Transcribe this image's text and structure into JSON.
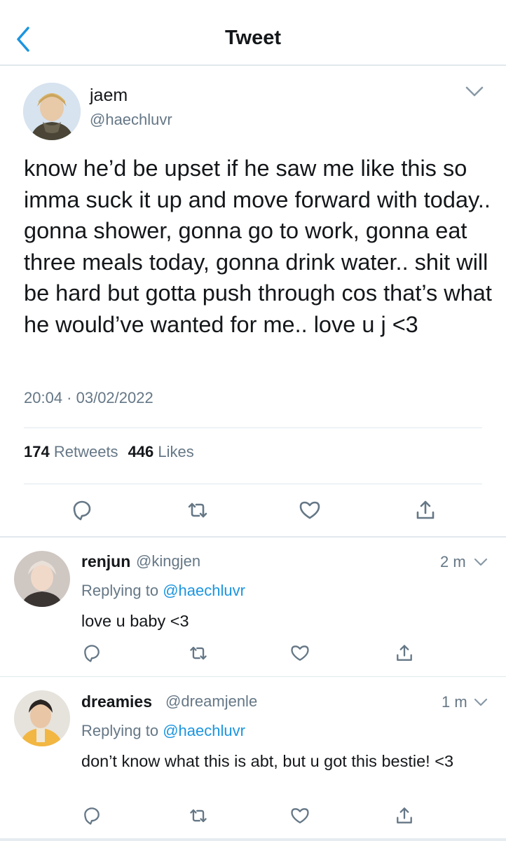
{
  "header": {
    "title": "Tweet"
  },
  "main_tweet": {
    "name": "jaem",
    "handle": "@haechluvr",
    "text": "know he’d be upset if he saw me like this so imma suck it up and move forward with today.. gonna shower, gonna go to work, gonna eat three meals today, gonna drink water.. shit will be hard but gotta push through cos that’s what he would’ve wanted for me.. love u j <3",
    "timestamp": "20:04 · 03/02/2022",
    "retweets_count": "174",
    "retweets_label": "Retweets",
    "likes_count": "446",
    "likes_label": "Likes"
  },
  "replies": [
    {
      "name": "renjun",
      "handle": "@kingjen",
      "time": "2 m",
      "replying_prefix": "Replying to",
      "replying_to": "@haechluvr",
      "text": "love u baby <3"
    },
    {
      "name": "dreamies",
      "handle": "@dreamjenle",
      "time": "1 m",
      "replying_prefix": "Replying to",
      "replying_to": "@haechluvr",
      "text": "don’t know what this is abt, but u got this bestie! <3"
    }
  ],
  "colors": {
    "text": "#14171a",
    "secondary": "#657786",
    "link": "#1b95e0",
    "divider": "#e1e8ed"
  },
  "icons": [
    "back-chevron-icon",
    "chevron-down-icon",
    "reply-icon",
    "retweet-icon",
    "like-icon",
    "share-icon"
  ]
}
